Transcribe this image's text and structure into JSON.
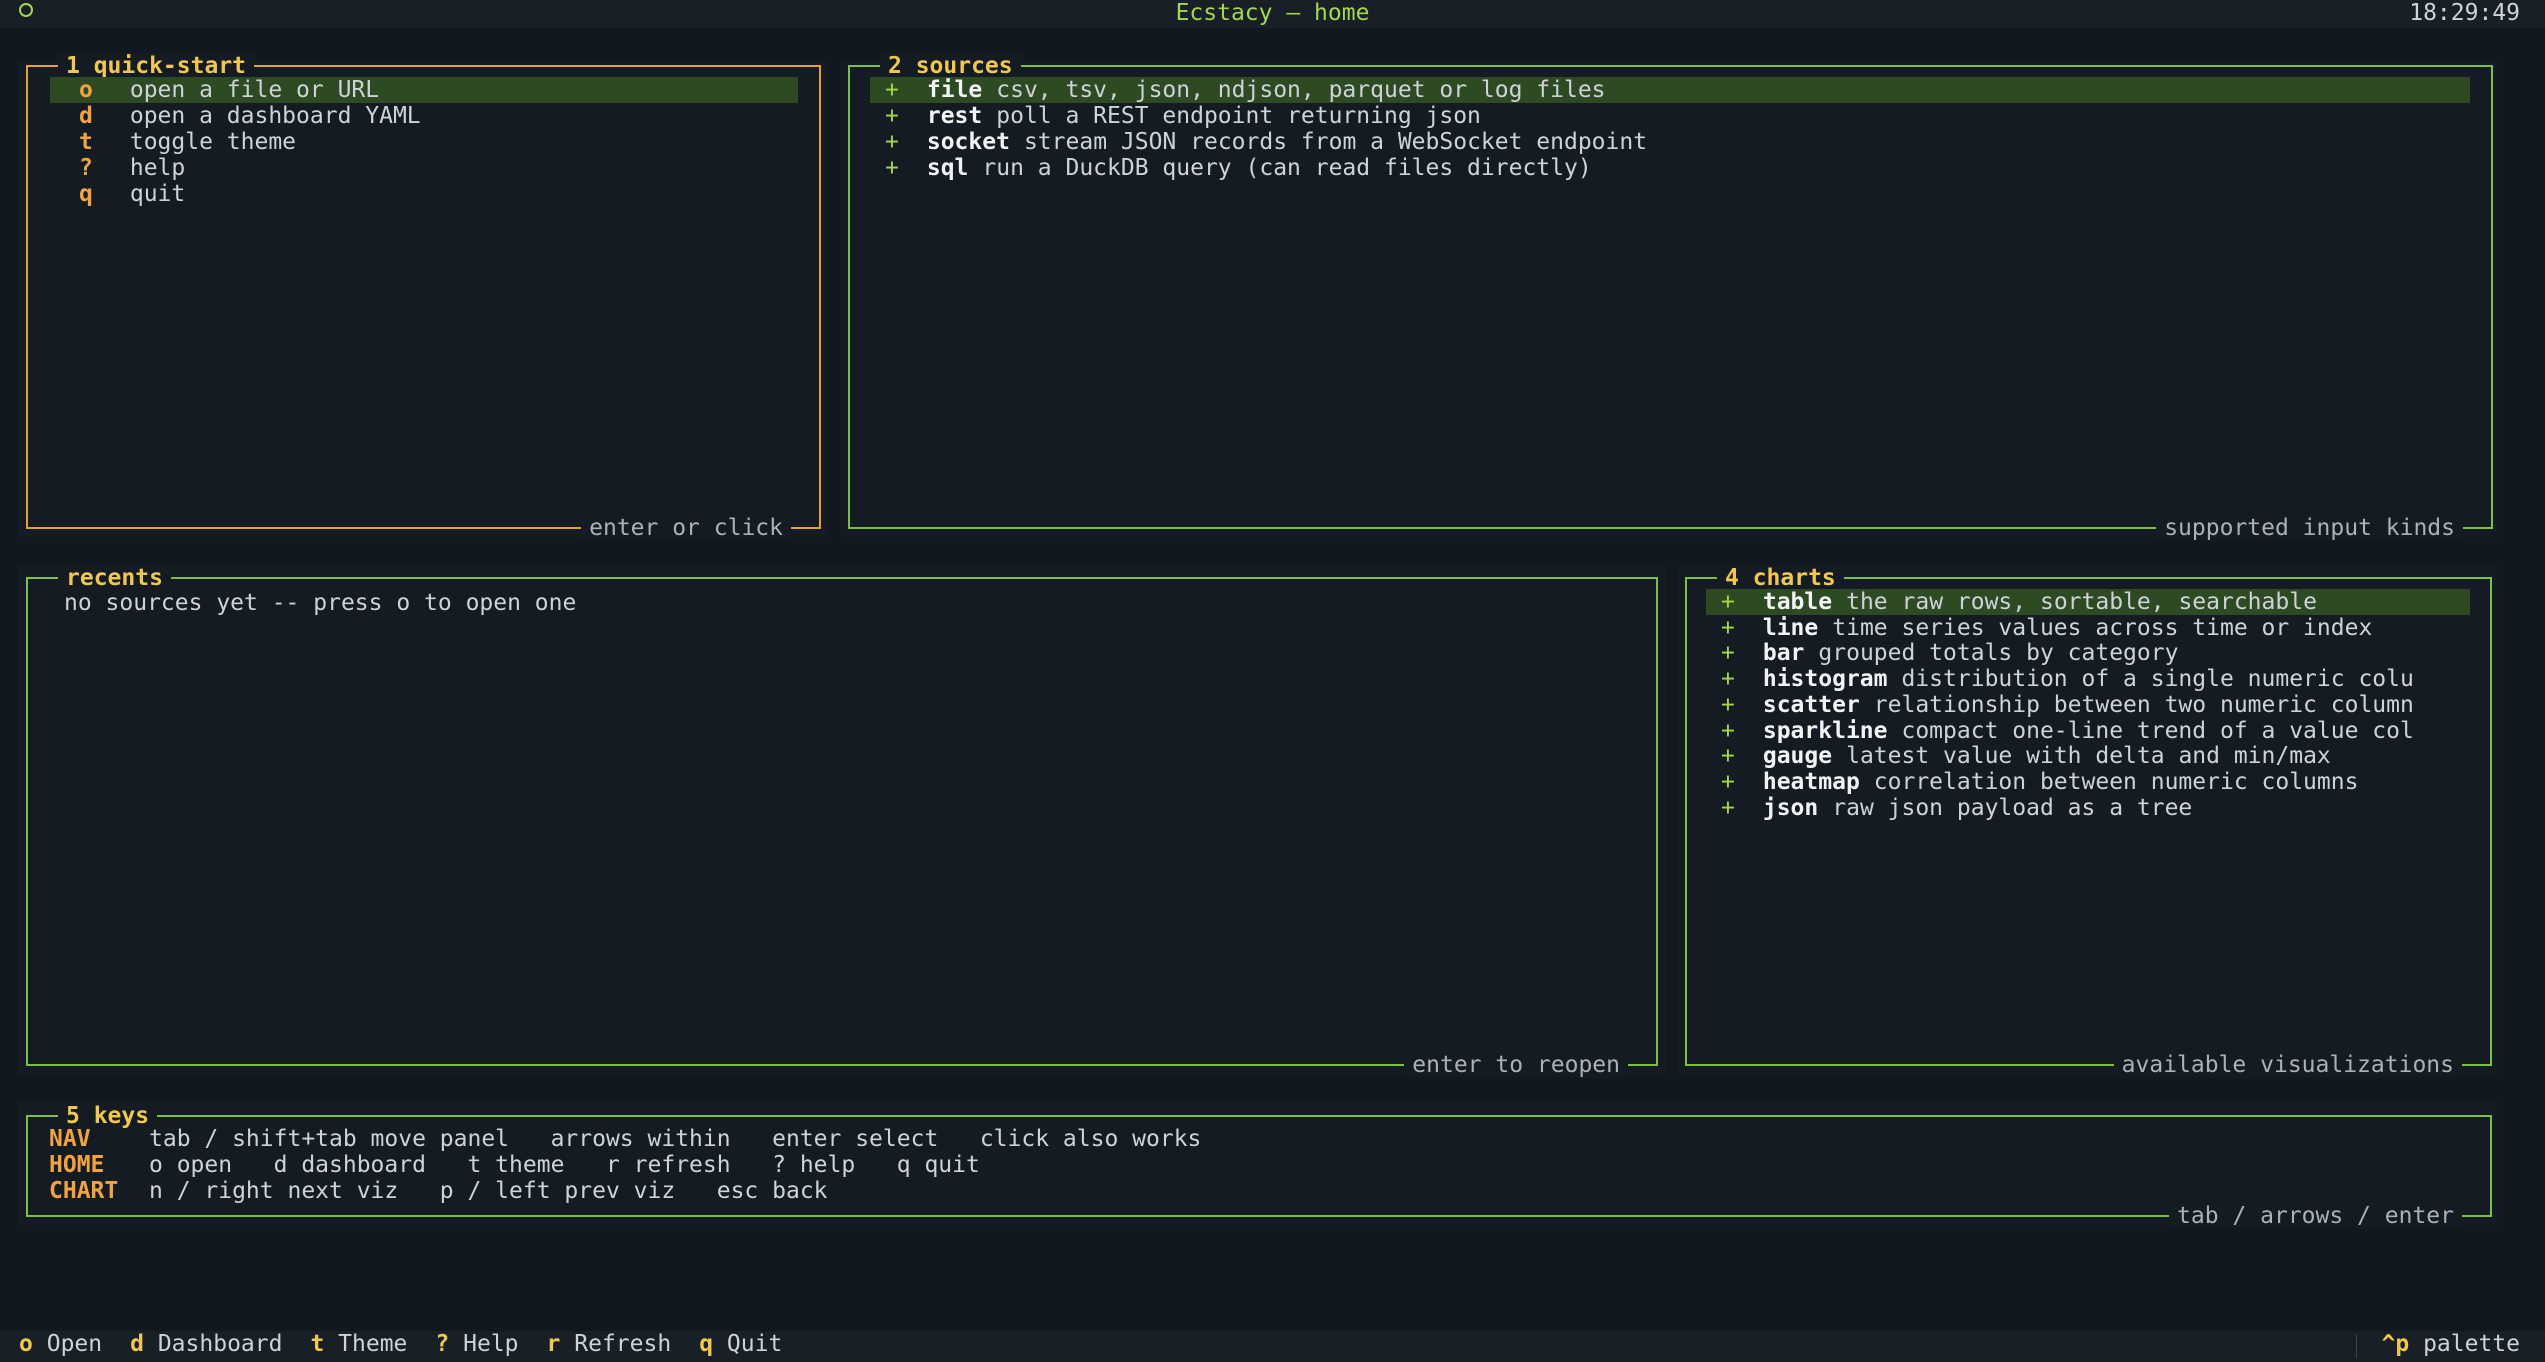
{
  "app": {
    "title": "Ecstacy — home",
    "clock": "18:29:49"
  },
  "quickstart": {
    "title": "1 quick-start",
    "footer": "enter or click",
    "items": [
      {
        "key": "o",
        "label": "open a file or URL"
      },
      {
        "key": "d",
        "label": "open a dashboard YAML"
      },
      {
        "key": "t",
        "label": "toggle theme"
      },
      {
        "key": "?",
        "label": "help"
      },
      {
        "key": "q",
        "label": "quit"
      }
    ]
  },
  "sources": {
    "title": "2 sources",
    "footer": "supported input kinds",
    "items": [
      {
        "name": "file",
        "desc": "csv, tsv, json, ndjson, parquet or log files"
      },
      {
        "name": "rest",
        "desc": "poll a REST endpoint returning json"
      },
      {
        "name": "socket",
        "desc": "stream JSON records from a WebSocket endpoint"
      },
      {
        "name": "sql",
        "desc": "run a DuckDB query (can read files directly)"
      }
    ]
  },
  "recents": {
    "title": "recents",
    "footer": "enter to reopen",
    "empty": "no sources yet -- press o to open one"
  },
  "charts": {
    "title": "4 charts",
    "footer": "available visualizations",
    "items": [
      {
        "name": "table",
        "desc": "the raw rows, sortable, searchable"
      },
      {
        "name": "line",
        "desc": "time series values across time or index"
      },
      {
        "name": "bar",
        "desc": "grouped totals by category"
      },
      {
        "name": "histogram",
        "desc": "distribution of a single numeric colu"
      },
      {
        "name": "scatter",
        "desc": "relationship between two numeric column"
      },
      {
        "name": "sparkline",
        "desc": "compact one-line trend of a value col"
      },
      {
        "name": "gauge",
        "desc": "latest value with delta and min/max"
      },
      {
        "name": "heatmap",
        "desc": "correlation between numeric columns"
      },
      {
        "name": "json",
        "desc": "raw json payload as a tree"
      }
    ]
  },
  "keys": {
    "title": "5 keys",
    "footer": "tab / arrows / enter",
    "rows": [
      {
        "label": "NAV",
        "text": "tab / shift+tab move panel   arrows within   enter select   click also works"
      },
      {
        "label": "HOME",
        "text": "o open   d dashboard   t theme   r refresh   ? help   q quit"
      },
      {
        "label": "CHART",
        "text": "n / right next viz   p / left prev viz   esc back"
      }
    ]
  },
  "statusbar": {
    "bindings": [
      {
        "key": "o",
        "label": "Open"
      },
      {
        "key": "d",
        "label": "Dashboard"
      },
      {
        "key": "t",
        "label": "Theme"
      },
      {
        "key": "?",
        "label": "Help"
      },
      {
        "key": "r",
        "label": "Refresh"
      },
      {
        "key": "q",
        "label": "Quit"
      }
    ],
    "palette_key": "^p",
    "palette_label": "palette"
  },
  "colors": {
    "background": "#111820",
    "panel_border": "#7cc23a",
    "focused_border": "#e8a327",
    "title": "#f2c84b",
    "key": "#f2a33a",
    "selected_row": "#2e4a23"
  }
}
